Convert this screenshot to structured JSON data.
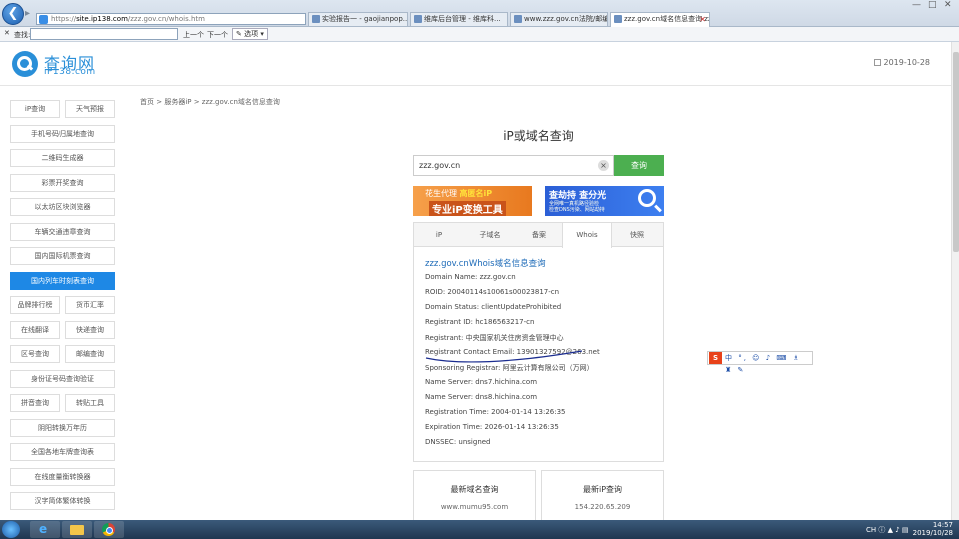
{
  "browser": {
    "address": {
      "scheme": "https://",
      "host": "site.ip138.com",
      "path": "/zzz.gov.cn/whois.htm"
    },
    "tabs": [
      {
        "label": "实验报告一 - gaojianpop..."
      },
      {
        "label": "维库后台管理 - 维库科..."
      },
      {
        "label": "www.zzz.gov.cn法院/邮编..."
      },
      {
        "label": "zzz.gov.cn域名信息查询 zz...",
        "active": true
      }
    ],
    "find_bar": {
      "label": "查找:",
      "prev": "上一个",
      "next": "下一个",
      "options": "选项"
    }
  },
  "site": {
    "logo_cn": "查询网",
    "logo_en": "iP138.com",
    "date": "2019-10-28"
  },
  "sidebar": {
    "items": [
      {
        "label": "iP查询"
      },
      {
        "label": "天气预报"
      },
      {
        "label": "手机号码归属地查询"
      },
      {
        "label": "二维码生成器"
      },
      {
        "label": "彩票开奖查询"
      },
      {
        "label": "以太坊区块浏览器"
      },
      {
        "label": "车辆交通违章查询"
      },
      {
        "label": "国内国际机票查询"
      },
      {
        "label": "国内列车时刻表查询",
        "active": true
      },
      {
        "label": "品牌排行榜"
      },
      {
        "label": "货币汇率"
      },
      {
        "label": "在线翻译"
      },
      {
        "label": "快递查询"
      },
      {
        "label": "区号查询"
      },
      {
        "label": "邮编查询"
      },
      {
        "label": "身份证号码查询验证"
      },
      {
        "label": "拼音查询"
      },
      {
        "label": "转贴工具"
      },
      {
        "label": "阴阳转换万年历"
      },
      {
        "label": "全国各地车牌查询表"
      },
      {
        "label": "在线度量衡转换器"
      },
      {
        "label": "汉字简体繁体转换"
      }
    ]
  },
  "main": {
    "breadcrumb": "首页 > 服务器iP > zzz.gov.cn域名信息查询",
    "title": "iP或域名查询",
    "search_value": "zzz.gov.cn",
    "clear": "×",
    "query_button": "查询",
    "ad_left": {
      "line1_a": "花生代理",
      "line1_b": "高匿名iP",
      "line2": "专业iP变换工具"
    },
    "ad_right": {
      "line1": "查劫持 查分光",
      "line2": "全网唯一真机路径验检",
      "line3": "检查DNS污染、网站劫持"
    },
    "tabs": [
      {
        "label": "iP"
      },
      {
        "label": "子域名"
      },
      {
        "label": "备案"
      },
      {
        "label": "Whois",
        "active": true
      },
      {
        "label": "快照"
      }
    ],
    "whois": {
      "title": "zzz.gov.cnWhois域名信息查询",
      "lines": [
        "Domain Name: zzz.gov.cn",
        "ROID: 20040114s10061s00023817-cn",
        "Domain Status: clientUpdateProhibited",
        "Registrant ID: hc186563217-cn",
        "Registrant: 中央国家机关住房资金管理中心",
        "Registrant Contact Email: 13901327592@263.net",
        "Sponsoring Registrar: 阿里云计算有限公司（万网）",
        "Name Server: dns7.hichina.com",
        "Name Server: dns8.hichina.com",
        "Registration Time: 2004-01-14 13:26:35",
        "Expiration Time: 2026-01-14 13:26:35",
        "DNSSEC: unsigned"
      ]
    },
    "latest_domain": {
      "title": "最新域名查询",
      "line": "www.mumu95.com"
    },
    "latest_ip": {
      "title": "最新iP查询",
      "line": "154.220.65.209"
    }
  },
  "ime": {
    "logo": "S",
    "text": "中 °, ☺ ♪ ⌨ ♗ ♜ ✎"
  },
  "taskbar": {
    "time": "14:57",
    "date": "2019/10/28",
    "lang": "CH"
  }
}
